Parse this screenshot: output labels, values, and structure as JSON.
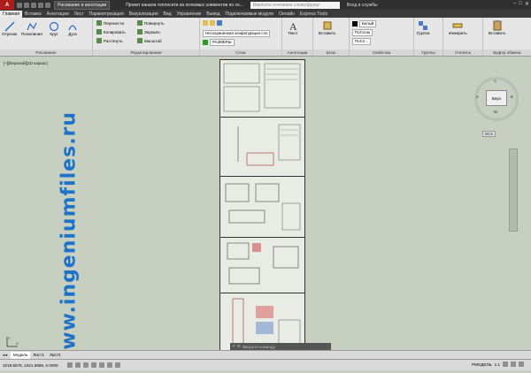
{
  "titlebar": {
    "app_letter": "A",
    "workspace": "Рисование и аннотации",
    "title": "Проект канала теплосети из лотковых элементов по се...",
    "search_placeholder": "Введите ключевое слово/фразу",
    "signin": "Вход в службы",
    "controls": [
      "–",
      "□",
      "✕"
    ]
  },
  "tabs": [
    "Главная",
    "Вставка",
    "Аннотации",
    "Лист",
    "Параметризация",
    "Визуализация",
    "Вид",
    "Управление",
    "Вывод",
    "Подключаемые модули",
    "Онлайн",
    "Express Tools"
  ],
  "ribbon": {
    "draw": {
      "title": "Рисование",
      "tools": [
        "Отрезок",
        "Полилиния",
        "Круг",
        "Дуга"
      ]
    },
    "modify": {
      "title": "Редактирование",
      "items": [
        "Перенести",
        "Повернуть",
        "Копировать",
        "Зеркало",
        "Растянуть",
        "Масштаб"
      ]
    },
    "layers": {
      "title": "Слои",
      "layer_state": "Несохраненная конфигурация сло",
      "current_layer": "РАЗМЕРЫ"
    },
    "annotation": {
      "title": "Аннотации",
      "text": "Текст"
    },
    "block": {
      "title": "Блок",
      "insert": "Вставить"
    },
    "properties": {
      "title": "Свойства",
      "color": "Белый",
      "linetype": "ПоСлою",
      "lineweight": "ПоСл..."
    },
    "groups": {
      "title": "Группы",
      "group": "Группа"
    },
    "utilities": {
      "title": "Утилиты",
      "measure": "Измерить"
    },
    "clipboard": {
      "title": "Буфер обмена",
      "paste": "Вставить"
    }
  },
  "viewport": {
    "label": "[–][Верхний][2D каркас]",
    "watermark": "www.ingeniumfiles.ru",
    "viewcube_face": "Верх",
    "compass": {
      "north": "С",
      "south": "Ю",
      "west": "З",
      "east": "В"
    },
    "ucs_label": "МСК",
    "cmd_placeholder": "Введите команду",
    "ucs_x": "X",
    "ucs_y": "Y"
  },
  "layout_tabs": [
    "Модель",
    "Лист1",
    "Лист2"
  ],
  "status": {
    "coords": "3219.5576, 2321.9869, 0.0000",
    "mode": "РМОДЕЛЬ",
    "scale": "1:1"
  },
  "colors": {
    "brand": "#b01c1c",
    "watermark": "#1e73c8",
    "viewport_bg": "#c7cfc0"
  }
}
